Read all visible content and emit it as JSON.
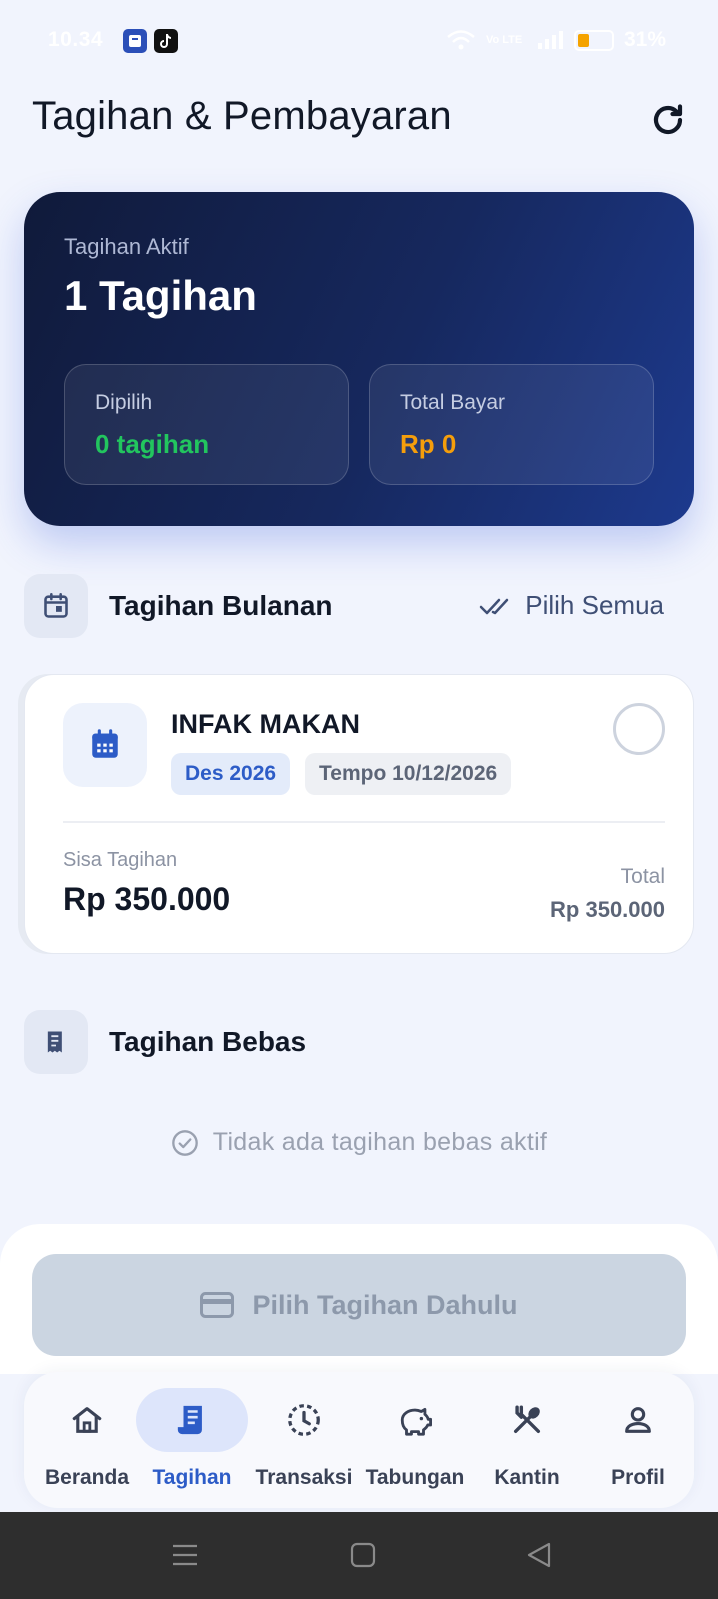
{
  "status_bar": {
    "time": "10.34",
    "network": "Vo LTE",
    "battery": "31%",
    "battery_level": 0.31,
    "battery_color": "#f5a300"
  },
  "header": {
    "title": "Tagihan & Pembayaran",
    "refresh_icon": "refresh-icon"
  },
  "summary": {
    "label": "Tagihan Aktif",
    "value": "1 Tagihan",
    "selected_label": "Dipilih",
    "selected_value": "0 tagihan",
    "selected_color": "#22c55e",
    "total_label": "Total Bayar",
    "total_value": "Rp 0",
    "total_color": "#f59e0b"
  },
  "monthly_section": {
    "title": "Tagihan Bulanan",
    "icon": "calendar-icon",
    "select_all_label": "Pilih Semua",
    "select_all_icon": "double-check-icon",
    "bills": [
      {
        "name": "INFAK MAKAN",
        "month": "Des 2026",
        "due": "Tempo 10/12/2026",
        "remaining_label": "Sisa Tagihan",
        "remaining_value": "Rp 350.000",
        "total_label": "Total",
        "total_value": "Rp 350.000",
        "selected": false
      }
    ]
  },
  "free_section": {
    "title": "Tagihan Bebas",
    "icon": "receipt-icon",
    "empty_message": "Tidak ada tagihan bebas aktif",
    "empty_icon": "check-circle-icon"
  },
  "pay_button": {
    "label": "Pilih Tagihan Dahulu",
    "icon": "credit-card-icon",
    "enabled": false
  },
  "bottom_nav": {
    "items": [
      {
        "label": "Beranda",
        "icon": "home-icon",
        "active": false
      },
      {
        "label": "Tagihan",
        "icon": "receipt-icon",
        "active": true
      },
      {
        "label": "Transaksi",
        "icon": "history-icon",
        "active": false
      },
      {
        "label": "Tabungan",
        "icon": "piggy-bank-icon",
        "active": false
      },
      {
        "label": "Kantin",
        "icon": "utensils-icon",
        "active": false
      },
      {
        "label": "Profil",
        "icon": "user-icon",
        "active": false
      }
    ]
  },
  "accent_color": "#2d5cc7"
}
